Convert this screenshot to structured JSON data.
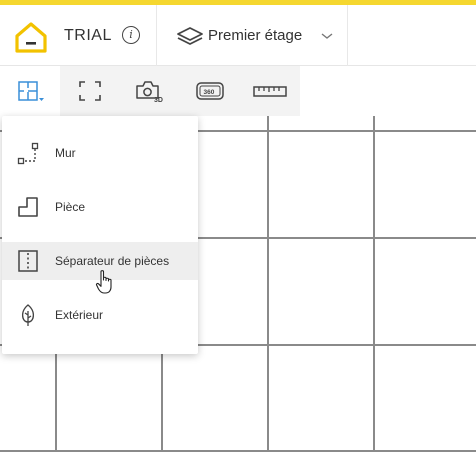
{
  "header": {
    "project_name": "TRIAL",
    "info_glyph": "i",
    "floor_name": "Premier étage",
    "icons": [
      "home-logo-icon",
      "info-icon",
      "layers-icon",
      "chevron-down-icon"
    ]
  },
  "toolbar": {
    "tools": [
      {
        "name": "build-tool",
        "icon": "floorplan-icon",
        "active": true
      },
      {
        "name": "fullscreen-tool",
        "icon": "fullscreen-icon",
        "active": false
      },
      {
        "name": "camera-3d-tool",
        "icon": "camera-3d-icon",
        "badge": "3D",
        "active": false
      },
      {
        "name": "view-360-tool",
        "icon": "view-360-icon",
        "badge": "360",
        "active": false
      },
      {
        "name": "measure-tool",
        "icon": "ruler-icon",
        "active": false
      }
    ]
  },
  "menu": {
    "items": [
      {
        "label": "Mur",
        "icon": "wall-icon"
      },
      {
        "label": "Pièce",
        "icon": "room-icon"
      },
      {
        "label": "Séparateur de pièces",
        "icon": "room-separator-icon",
        "hovered": true
      },
      {
        "label": "Extérieur",
        "icon": "tree-icon"
      }
    ]
  },
  "colors": {
    "accent": "#f5d72f",
    "toolbar_bg": "#f3f3f3",
    "active_tool_icon": "#3a8fd8",
    "grid_line": "#8a8a8a",
    "hover_bg": "#eeeeee"
  }
}
